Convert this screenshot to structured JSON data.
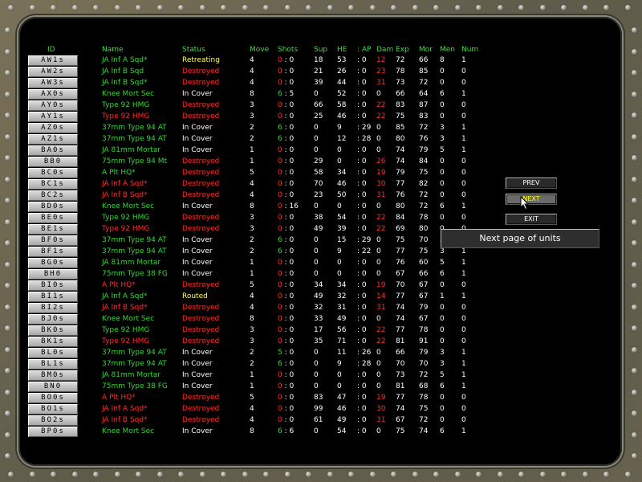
{
  "headers": [
    "ID",
    "Name",
    "Status",
    "Move",
    "Shots",
    "Sup",
    "HE",
    ": AP",
    "Dam",
    "Exp",
    "Mor",
    "Men",
    "Num"
  ],
  "units": [
    {
      "id": "AW1s",
      "name": "JA Inf A Sqd*",
      "status": "Retreating",
      "move": "4",
      "shots_a": "0",
      "shots_b": "0",
      "sup": "18",
      "he": "53",
      "ap": "0",
      "dam": "12",
      "exp": "72",
      "mor": "66",
      "men": "8",
      "num": "1",
      "nc": "green",
      "sc": "yellow",
      "dc": "red",
      "shc": "red"
    },
    {
      "id": "AW2s",
      "name": "JA Inf B Sqd",
      "status": "Destroyed",
      "move": "4",
      "shots_a": "0",
      "shots_b": "0",
      "sup": "21",
      "he": "26",
      "ap": "0",
      "dam": "23",
      "exp": "78",
      "mor": "85",
      "men": "0",
      "num": "0",
      "nc": "green",
      "sc": "red",
      "dc": "red",
      "shc": "red"
    },
    {
      "id": "AW3s",
      "name": "JA Inf B Sqd*",
      "status": "Destroyed",
      "move": "4",
      "shots_a": "0",
      "shots_b": "0",
      "sup": "39",
      "he": "44",
      "ap": "0",
      "dam": "31",
      "exp": "73",
      "mor": "72",
      "men": "0",
      "num": "0",
      "nc": "green",
      "sc": "red",
      "dc": "red",
      "shc": "red"
    },
    {
      "id": "AX0s",
      "name": "Knee Mort Sec",
      "status": "In Cover",
      "move": "8",
      "shots_a": "6",
      "shots_b": "5",
      "sup": "0",
      "he": "52",
      "ap": "0",
      "dam": "0",
      "exp": "66",
      "mor": "64",
      "men": "6",
      "num": "1",
      "nc": "green",
      "sc": "white",
      "dc": "white",
      "shc": "green"
    },
    {
      "id": "AY0s",
      "name": "Type 92 HMG",
      "status": "Destroyed",
      "move": "3",
      "shots_a": "0",
      "shots_b": "0",
      "sup": "66",
      "he": "58",
      "ap": "0",
      "dam": "22",
      "exp": "83",
      "mor": "87",
      "men": "0",
      "num": "0",
      "nc": "green",
      "sc": "red",
      "dc": "red",
      "shc": "red"
    },
    {
      "id": "AY1s",
      "name": "Type 92 HMG",
      "status": "Destroyed",
      "move": "3",
      "shots_a": "0",
      "shots_b": "0",
      "sup": "25",
      "he": "46",
      "ap": "0",
      "dam": "22",
      "exp": "75",
      "mor": "83",
      "men": "0",
      "num": "0",
      "nc": "red",
      "sc": "red",
      "dc": "red",
      "shc": "red"
    },
    {
      "id": "AZ0s",
      "name": "37mm Type 94 AT",
      "status": "In Cover",
      "move": "2",
      "shots_a": "6",
      "shots_b": "0",
      "sup": "0",
      "he": "9",
      "ap": "29",
      "dam": "0",
      "exp": "85",
      "mor": "72",
      "men": "3",
      "num": "1",
      "nc": "green",
      "sc": "white",
      "dc": "white",
      "shc": "green"
    },
    {
      "id": "AZ1s",
      "name": "37mm Type 94 AT",
      "status": "In Cover",
      "move": "2",
      "shots_a": "6",
      "shots_b": "0",
      "sup": "0",
      "he": "12",
      "ap": "28",
      "dam": "0",
      "exp": "80",
      "mor": "76",
      "men": "3",
      "num": "1",
      "nc": "green",
      "sc": "white",
      "dc": "white",
      "shc": "green"
    },
    {
      "id": "BA0s",
      "name": "JA 81mm Mortar",
      "status": "In Cover",
      "move": "1",
      "shots_a": "0",
      "shots_b": "0",
      "sup": "0",
      "he": "0",
      "ap": "0",
      "dam": "0",
      "exp": "74",
      "mor": "79",
      "men": "5",
      "num": "1",
      "nc": "green",
      "sc": "white",
      "dc": "white",
      "shc": "red"
    },
    {
      "id": "BB0",
      "name": "75mm Type 94 Mt",
      "status": "Destroyed",
      "move": "1",
      "shots_a": "0",
      "shots_b": "0",
      "sup": "29",
      "he": "0",
      "ap": "0",
      "dam": "26",
      "exp": "74",
      "mor": "84",
      "men": "0",
      "num": "0",
      "nc": "green",
      "sc": "red",
      "dc": "red",
      "shc": "red"
    },
    {
      "id": "BC0s",
      "name": "A Plt HQ*",
      "status": "Destroyed",
      "move": "5",
      "shots_a": "0",
      "shots_b": "0",
      "sup": "58",
      "he": "34",
      "ap": "0",
      "dam": "19",
      "exp": "79",
      "mor": "75",
      "men": "0",
      "num": "0",
      "nc": "green",
      "sc": "red",
      "dc": "red",
      "shc": "red"
    },
    {
      "id": "BC1s",
      "name": "JA Inf A Sqd*",
      "status": "Destroyed",
      "move": "4",
      "shots_a": "0",
      "shots_b": "0",
      "sup": "70",
      "he": "46",
      "ap": "0",
      "dam": "30",
      "exp": "77",
      "mor": "82",
      "men": "0",
      "num": "0",
      "nc": "red",
      "sc": "red",
      "dc": "red",
      "shc": "red"
    },
    {
      "id": "BC2s",
      "name": "JA Inf B Sqd*",
      "status": "Destroyed",
      "move": "4",
      "shots_a": "0",
      "shots_b": "0",
      "sup": "23",
      "he": "50",
      "ap": "0",
      "dam": "31",
      "exp": "76",
      "mor": "72",
      "men": "0",
      "num": "0",
      "nc": "red",
      "sc": "red",
      "dc": "red",
      "shc": "red"
    },
    {
      "id": "BD0s",
      "name": "Knee Mort Sec",
      "status": "In Cover",
      "move": "8",
      "shots_a": "0",
      "shots_b": "16",
      "sup": "0",
      "he": "0",
      "ap": "0",
      "dam": "0",
      "exp": "80",
      "mor": "72",
      "men": "6",
      "num": "1",
      "nc": "green",
      "sc": "white",
      "dc": "white",
      "shc": "red"
    },
    {
      "id": "BE0s",
      "name": "Type 92 HMG",
      "status": "Destroyed",
      "move": "3",
      "shots_a": "0",
      "shots_b": "0",
      "sup": "38",
      "he": "54",
      "ap": "0",
      "dam": "22",
      "exp": "84",
      "mor": "78",
      "men": "0",
      "num": "0",
      "nc": "green",
      "sc": "red",
      "dc": "red",
      "shc": "red"
    },
    {
      "id": "BE1s",
      "name": "Type 92 HMG",
      "status": "Destroyed",
      "move": "3",
      "shots_a": "0",
      "shots_b": "0",
      "sup": "49",
      "he": "39",
      "ap": "0",
      "dam": "22",
      "exp": "69",
      "mor": "80",
      "men": "0",
      "num": "0",
      "nc": "red",
      "sc": "red",
      "dc": "red",
      "shc": "red"
    },
    {
      "id": "BF0s",
      "name": "37mm Type 94 AT",
      "status": "In Cover",
      "move": "2",
      "shots_a": "6",
      "shots_b": "0",
      "sup": "0",
      "he": "15",
      "ap": "29",
      "dam": "0",
      "exp": "75",
      "mor": "70",
      "men": "3",
      "num": "1",
      "nc": "green",
      "sc": "white",
      "dc": "white",
      "shc": "green"
    },
    {
      "id": "BF1s",
      "name": "37mm Type 94 AT",
      "status": "In Cover",
      "move": "2",
      "shots_a": "6",
      "shots_b": "0",
      "sup": "0",
      "he": "9",
      "ap": "22",
      "dam": "0",
      "exp": "77",
      "mor": "75",
      "men": "3",
      "num": "1",
      "nc": "green",
      "sc": "white",
      "dc": "white",
      "shc": "green"
    },
    {
      "id": "BG0s",
      "name": "JA 81mm Mortar",
      "status": "In Cover",
      "move": "1",
      "shots_a": "0",
      "shots_b": "0",
      "sup": "0",
      "he": "0",
      "ap": "0",
      "dam": "0",
      "exp": "76",
      "mor": "60",
      "men": "5",
      "num": "1",
      "nc": "green",
      "sc": "white",
      "dc": "white",
      "shc": "red"
    },
    {
      "id": "BH0",
      "name": "75mm Type 38 FG",
      "status": "In Cover",
      "move": "1",
      "shots_a": "0",
      "shots_b": "0",
      "sup": "0",
      "he": "0",
      "ap": "0",
      "dam": "0",
      "exp": "67",
      "mor": "66",
      "men": "6",
      "num": "1",
      "nc": "green",
      "sc": "white",
      "dc": "white",
      "shc": "red"
    },
    {
      "id": "BI0s",
      "name": "A Plt HQ*",
      "status": "Destroyed",
      "move": "5",
      "shots_a": "0",
      "shots_b": "0",
      "sup": "34",
      "he": "34",
      "ap": "0",
      "dam": "19",
      "exp": "70",
      "mor": "67",
      "men": "0",
      "num": "0",
      "nc": "red",
      "sc": "red",
      "dc": "red",
      "shc": "red"
    },
    {
      "id": "BI1s",
      "name": "JA Inf A Sqd*",
      "status": "Routed",
      "move": "4",
      "shots_a": "0",
      "shots_b": "0",
      "sup": "49",
      "he": "32",
      "ap": "0",
      "dam": "14",
      "exp": "77",
      "mor": "67",
      "men": "1",
      "num": "1",
      "nc": "green",
      "sc": "yellow",
      "dc": "red",
      "shc": "red"
    },
    {
      "id": "BI2s",
      "name": "JA Inf B Sqd*",
      "status": "Destroyed",
      "move": "4",
      "shots_a": "0",
      "shots_b": "0",
      "sup": "32",
      "he": "31",
      "ap": "0",
      "dam": "31",
      "exp": "74",
      "mor": "79",
      "men": "0",
      "num": "0",
      "nc": "red",
      "sc": "red",
      "dc": "red",
      "shc": "red"
    },
    {
      "id": "BJ0s",
      "name": "Knee Mort Sec",
      "status": "Destroyed",
      "move": "8",
      "shots_a": "0",
      "shots_b": "0",
      "sup": "33",
      "he": "49",
      "ap": "0",
      "dam": "0",
      "exp": "74",
      "mor": "67",
      "men": "0",
      "num": "0",
      "nc": "green",
      "sc": "red",
      "dc": "white",
      "shc": "red"
    },
    {
      "id": "BK0s",
      "name": "Type 92 HMG",
      "status": "Destroyed",
      "move": "3",
      "shots_a": "0",
      "shots_b": "0",
      "sup": "17",
      "he": "56",
      "ap": "0",
      "dam": "22",
      "exp": "77",
      "mor": "78",
      "men": "0",
      "num": "0",
      "nc": "green",
      "sc": "red",
      "dc": "red",
      "shc": "red"
    },
    {
      "id": "BK1s",
      "name": "Type 92 HMG",
      "status": "Destroyed",
      "move": "3",
      "shots_a": "0",
      "shots_b": "0",
      "sup": "35",
      "he": "71",
      "ap": "0",
      "dam": "22",
      "exp": "81",
      "mor": "91",
      "men": "0",
      "num": "0",
      "nc": "red",
      "sc": "red",
      "dc": "red",
      "shc": "red"
    },
    {
      "id": "BL0s",
      "name": "37mm Type 94 AT",
      "status": "In Cover",
      "move": "2",
      "shots_a": "5",
      "shots_b": "0",
      "sup": "0",
      "he": "11",
      "ap": "26",
      "dam": "0",
      "exp": "66",
      "mor": "79",
      "men": "3",
      "num": "1",
      "nc": "green",
      "sc": "white",
      "dc": "white",
      "shc": "green"
    },
    {
      "id": "BL1s",
      "name": "37mm Type 94 AT",
      "status": "In Cover",
      "move": "2",
      "shots_a": "6",
      "shots_b": "0",
      "sup": "0",
      "he": "9",
      "ap": "28",
      "dam": "0",
      "exp": "70",
      "mor": "70",
      "men": "3",
      "num": "1",
      "nc": "green",
      "sc": "white",
      "dc": "white",
      "shc": "green"
    },
    {
      "id": "BM0s",
      "name": "JA 81mm Mortar",
      "status": "In Cover",
      "move": "1",
      "shots_a": "0",
      "shots_b": "0",
      "sup": "0",
      "he": "0",
      "ap": "0",
      "dam": "0",
      "exp": "73",
      "mor": "72",
      "men": "5",
      "num": "1",
      "nc": "green",
      "sc": "white",
      "dc": "white",
      "shc": "red"
    },
    {
      "id": "BN0",
      "name": "75mm Type 38 FG",
      "status": "In Cover",
      "move": "1",
      "shots_a": "0",
      "shots_b": "0",
      "sup": "0",
      "he": "0",
      "ap": "0",
      "dam": "0",
      "exp": "81",
      "mor": "68",
      "men": "6",
      "num": "1",
      "nc": "green",
      "sc": "white",
      "dc": "white",
      "shc": "red"
    },
    {
      "id": "BO0s",
      "name": "A Plt HQ*",
      "status": "Destroyed",
      "move": "5",
      "shots_a": "0",
      "shots_b": "0",
      "sup": "83",
      "he": "47",
      "ap": "0",
      "dam": "19",
      "exp": "77",
      "mor": "78",
      "men": "0",
      "num": "0",
      "nc": "red",
      "sc": "red",
      "dc": "red",
      "shc": "red"
    },
    {
      "id": "BO1s",
      "name": "JA Inf A Sqd*",
      "status": "Destroyed",
      "move": "4",
      "shots_a": "0",
      "shots_b": "0",
      "sup": "99",
      "he": "46",
      "ap": "0",
      "dam": "30",
      "exp": "74",
      "mor": "75",
      "men": "0",
      "num": "0",
      "nc": "red",
      "sc": "red",
      "dc": "red",
      "shc": "red"
    },
    {
      "id": "BO2s",
      "name": "JA Inf B Sqd*",
      "status": "Destroyed",
      "move": "4",
      "shots_a": "0",
      "shots_b": "0",
      "sup": "61",
      "he": "49",
      "ap": "0",
      "dam": "31",
      "exp": "67",
      "mor": "72",
      "men": "0",
      "num": "0",
      "nc": "red",
      "sc": "red",
      "dc": "red",
      "shc": "red"
    },
    {
      "id": "BP0s",
      "name": "Knee Mort Sec",
      "status": "In Cover",
      "move": "8",
      "shots_a": "6",
      "shots_b": "6",
      "sup": "0",
      "he": "54",
      "ap": "0",
      "dam": "0",
      "exp": "75",
      "mor": "74",
      "men": "6",
      "num": "1",
      "nc": "green",
      "sc": "white",
      "dc": "white",
      "shc": "green"
    }
  ],
  "buttons": {
    "prev": "PREV",
    "next": "NEXT",
    "exit": "EXIT"
  },
  "tooltip": "Next page of units"
}
